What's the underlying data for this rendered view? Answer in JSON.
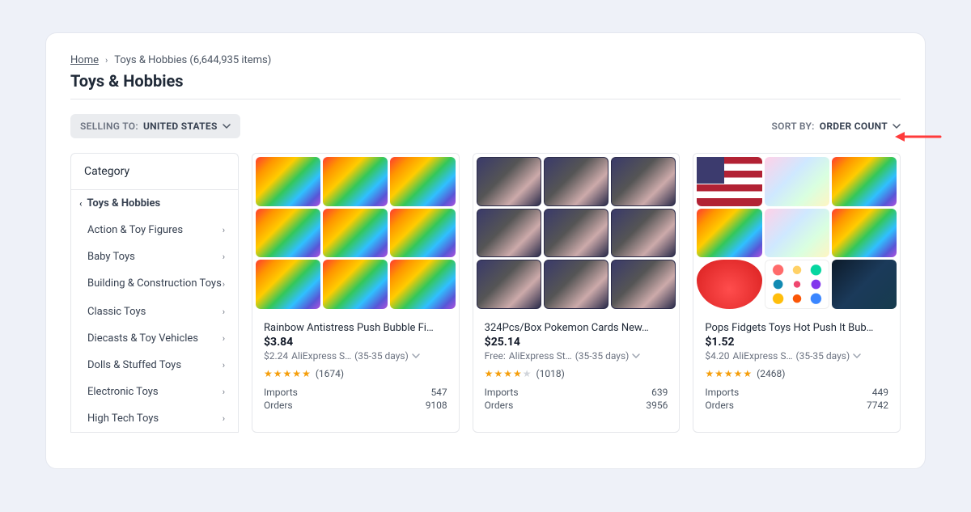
{
  "breadcrumb": {
    "home": "Home",
    "current": "Toys & Hobbies (6,644,935 items)"
  },
  "page_title": "Toys & Hobbies",
  "filters": {
    "selling_to_label": "SELLING TO:",
    "selling_to_value": "UNITED STATES",
    "sort_label": "SORT BY:",
    "sort_value": "ORDER COUNT"
  },
  "sidebar": {
    "header": "Category",
    "parent": "Toys & Hobbies",
    "items": [
      "Action & Toy Figures",
      "Baby Toys",
      "Building & Construction Toys",
      "Classic Toys",
      "Diecasts & Toy Vehicles",
      "Dolls & Stuffed Toys",
      "Electronic Toys",
      "High Tech Toys"
    ]
  },
  "labels": {
    "imports": "Imports",
    "orders": "Orders"
  },
  "products": [
    {
      "title": "Rainbow Antistress Push Bubble Fi…",
      "price": "$3.84",
      "ship_price": "$2.24",
      "ship_carrier": "AliExpress S…",
      "ship_eta": "(35-35 days)",
      "rating_stars": 5,
      "rating_count": "(1674)",
      "imports": "547",
      "orders": "9108",
      "thumb_style": "rainbow"
    },
    {
      "title": "324Pcs/Box Pokemon Cards New…",
      "price": "$25.14",
      "ship_price": "Free:",
      "ship_carrier": "AliExpress St…",
      "ship_eta": "(35-35 days)",
      "rating_stars": 4,
      "rating_count": "(1018)",
      "imports": "639",
      "orders": "3956",
      "thumb_style": "pokemon"
    },
    {
      "title": "Pops Fidgets Toys Hot Push It Bub…",
      "price": "$1.52",
      "ship_price": "$4.20",
      "ship_carrier": "AliExpress S…",
      "ship_eta": "(35-35 days)",
      "rating_stars": 5,
      "rating_count": "(2468)",
      "imports": "449",
      "orders": "7742",
      "thumb_style": "fidget"
    }
  ]
}
